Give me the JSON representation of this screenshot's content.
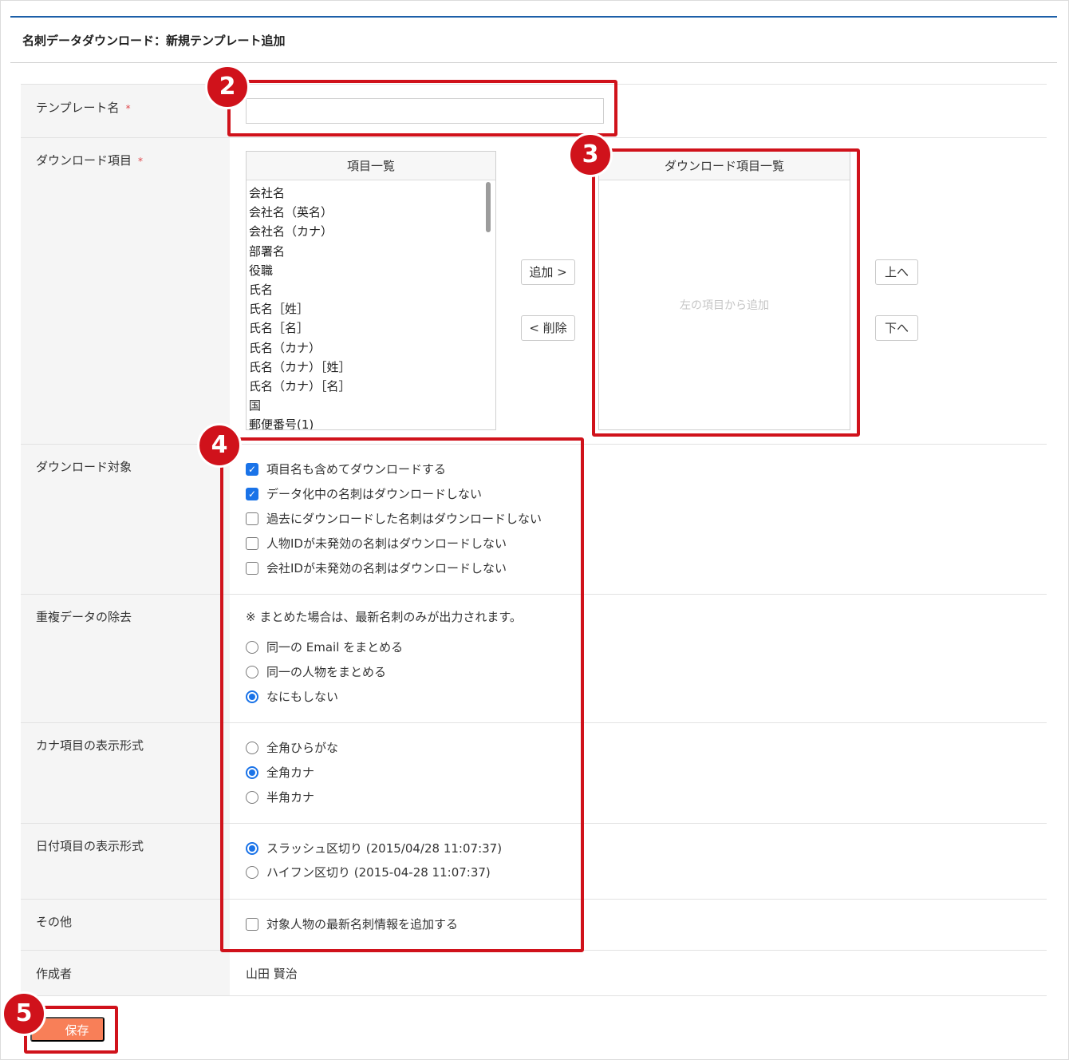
{
  "page": {
    "title": "名刺データダウンロード：新規テンプレート追加"
  },
  "form": {
    "template_name": {
      "label": "テンプレート名",
      "required_mark": "*",
      "value": ""
    },
    "download_items": {
      "label": "ダウンロード項目",
      "required_mark": "*",
      "available_header": "項目一覧",
      "available_items": [
        "会社名",
        "会社名（英名）",
        "会社名（カナ）",
        "部署名",
        "役職",
        "氏名",
        "氏名［姓］",
        "氏名［名］",
        "氏名（カナ）",
        "氏名（カナ）［姓］",
        "氏名（カナ）［名］",
        "国",
        "郵便番号(1)"
      ],
      "selected_header": "ダウンロード項目一覧",
      "selected_empty_hint": "左の項目から追加",
      "add_button": "追加 >",
      "remove_button": "< 削除",
      "up_button": "上へ",
      "down_button": "下へ"
    },
    "download_target": {
      "label": "ダウンロード対象",
      "options": [
        {
          "label": "項目名も含めてダウンロードする",
          "checked": true
        },
        {
          "label": "データ化中の名刺はダウンロードしない",
          "checked": true
        },
        {
          "label": "過去にダウンロードした名刺はダウンロードしない",
          "checked": false
        },
        {
          "label": "人物IDが未発効の名刺はダウンロードしない",
          "checked": false
        },
        {
          "label": "会社IDが未発効の名刺はダウンロードしない",
          "checked": false
        }
      ]
    },
    "dedupe": {
      "label": "重複データの除去",
      "note": "※ まとめた場合は、最新名刺のみが出力されます。",
      "options": [
        {
          "label": "同一の Email をまとめる",
          "selected": false
        },
        {
          "label": "同一の人物をまとめる",
          "selected": false
        },
        {
          "label": "なにもしない",
          "selected": true
        }
      ]
    },
    "kana_format": {
      "label": "カナ項目の表示形式",
      "options": [
        {
          "label": "全角ひらがな",
          "selected": false
        },
        {
          "label": "全角カナ",
          "selected": true
        },
        {
          "label": "半角カナ",
          "selected": false
        }
      ]
    },
    "date_format": {
      "label": "日付項目の表示形式",
      "options": [
        {
          "label": "スラッシュ区切り (2015/04/28 11:07:37)",
          "selected": true
        },
        {
          "label": "ハイフン区切り (2015-04-28 11:07:37)",
          "selected": false
        }
      ]
    },
    "other": {
      "label": "その他",
      "options": [
        {
          "label": "対象人物の最新名刺情報を追加する",
          "checked": false
        }
      ]
    },
    "author": {
      "label": "作成者",
      "value": "山田 賢治"
    }
  },
  "save_button": "保存",
  "callouts": [
    "2",
    "3",
    "4",
    "5"
  ],
  "colors": {
    "accent_rule": "#1c5fa8",
    "callout": "#d0121b",
    "save_button": "#f87f58",
    "checkbox_on": "#1a73e8"
  }
}
